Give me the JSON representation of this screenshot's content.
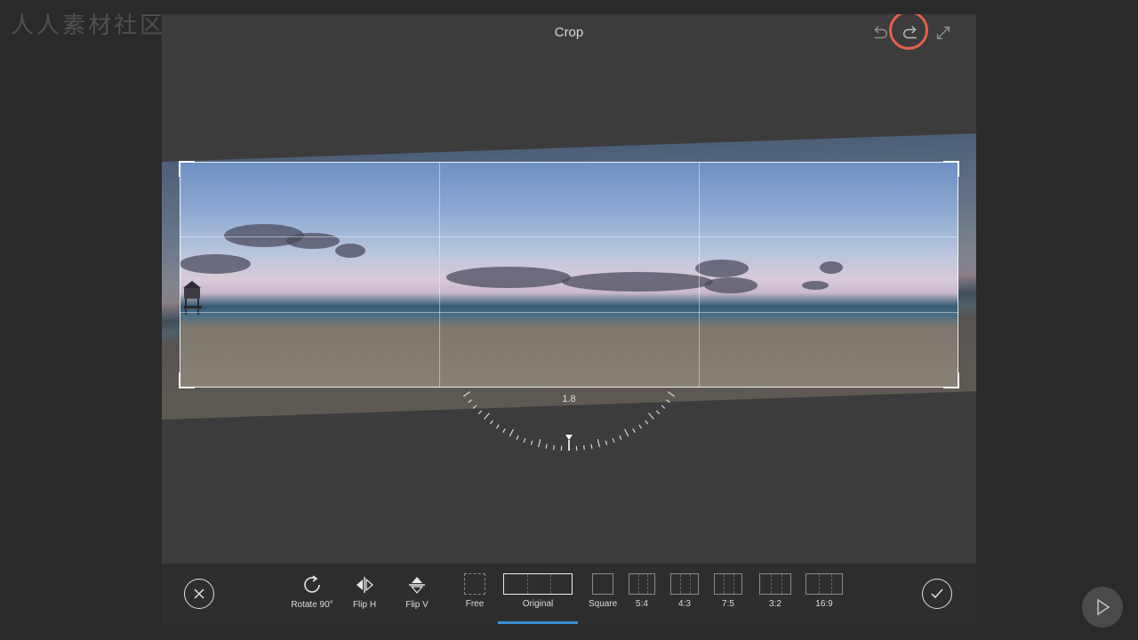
{
  "watermark": "人人素材社区",
  "header": {
    "title": "Crop"
  },
  "dial": {
    "value": "1.8"
  },
  "tools": [
    {
      "label": "Rotate 90°",
      "icon": "rotate-icon"
    },
    {
      "label": "Flip H",
      "icon": "flip-horizontal-icon"
    },
    {
      "label": "Flip V",
      "icon": "flip-vertical-icon"
    }
  ],
  "aspects": [
    {
      "label": "Free"
    },
    {
      "label": "Original"
    },
    {
      "label": "Square"
    },
    {
      "label": "5:4"
    },
    {
      "label": "4:3"
    },
    {
      "label": "7:5"
    },
    {
      "label": "3:2"
    },
    {
      "label": "16:9"
    }
  ],
  "selected_aspect": "Original",
  "colors": {
    "highlight": "#e8604a",
    "selection": "#3e8fd0"
  }
}
